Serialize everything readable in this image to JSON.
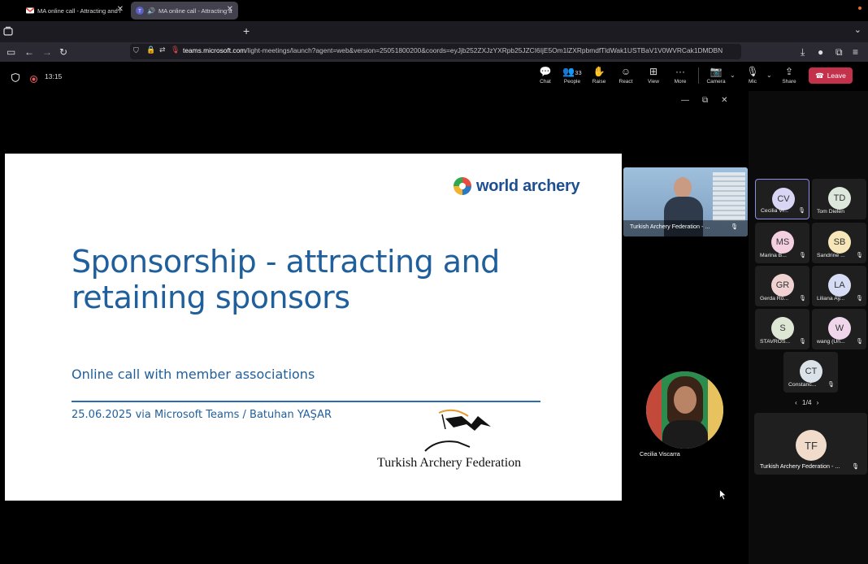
{
  "browser": {
    "tabs": [
      {
        "title": "MA online call - Attracting and r",
        "favicon": "gmail-icon",
        "active": false
      },
      {
        "title": "MA online call - Attracting a",
        "favicon": "teams-icon",
        "active": true
      }
    ],
    "url_domain": "teams.microsoft.com",
    "url_rest": "/light-meetings/launch?agent=web&version=25051800200&coords=eyJjb252ZXJzYXRpb25JZCI6IjE5Om1lZXRpbmdfTldWak1USTBaV1V0WVRCak1DMDBN"
  },
  "meeting": {
    "timer": "13:15",
    "toolbar": {
      "chat": "Chat",
      "people": "People",
      "people_count": "33",
      "raise": "Raise",
      "react": "React",
      "view": "View",
      "more": "More",
      "camera": "Camera",
      "mic": "Mic",
      "share": "Share",
      "leave": "Leave"
    }
  },
  "slide": {
    "brand": "world archery",
    "title": "Sponsorship - attracting and retaining sponsors",
    "subtitle": "Online call with member associations",
    "date_line": "25.06.2025 via Microsoft Teams / Batuhan YAŞAR",
    "federation": "Turkish Archery Federation"
  },
  "video": {
    "presenter_label": "Turkish Archery Federation - ...",
    "speaker_name": "Cecilia Viscarra"
  },
  "participants": [
    {
      "initials": "CV",
      "name": "Cecilia Vi...",
      "color": "#d9d6f5",
      "selected": true
    },
    {
      "initials": "TD",
      "name": "Tom Dielen",
      "color": "#dde7dc",
      "selected": false
    },
    {
      "initials": "MS",
      "name": "Marina B...",
      "color": "#f3cfe0",
      "selected": false
    },
    {
      "initials": "SB",
      "name": "Sandrine ...",
      "color": "#f6e6b8",
      "selected": false
    },
    {
      "initials": "GR",
      "name": "Gerda Ro...",
      "color": "#f0d2d2",
      "selected": false
    },
    {
      "initials": "LA",
      "name": "Liliana Ay...",
      "color": "#d6dcf3",
      "selected": false
    },
    {
      "initials": "S",
      "name": "STAVROS...",
      "color": "#dde7d4",
      "selected": false
    },
    {
      "initials": "W",
      "name": "wang (Un...",
      "color": "#f0d6ea",
      "selected": false
    },
    {
      "initials": "CT",
      "name": "Constanc...",
      "color": "#dbe3ea",
      "selected": false
    }
  ],
  "pager": "1/4",
  "featured_participant": {
    "initials": "TF",
    "name": "Turkish Archery Federation - ..."
  }
}
